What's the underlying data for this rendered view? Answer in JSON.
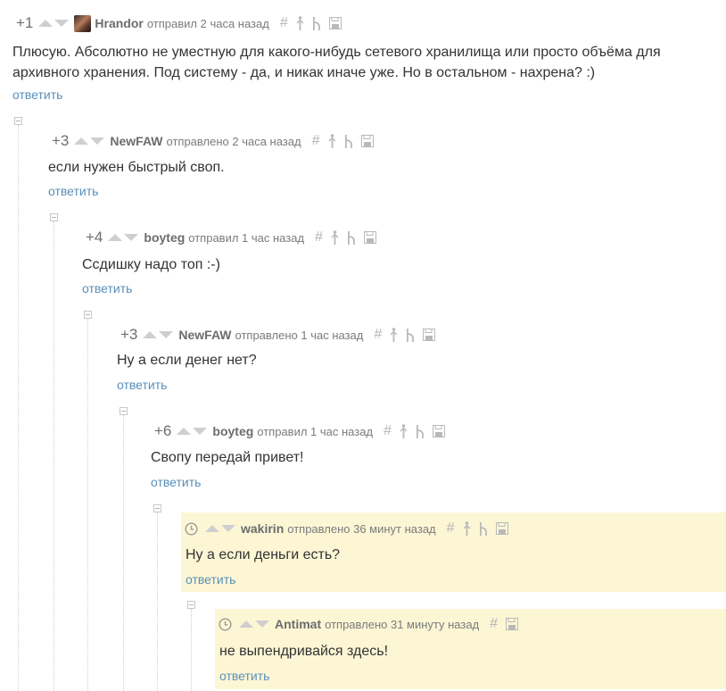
{
  "comments": [
    {
      "rating": "+1",
      "author": "Hrandor",
      "time": "отправил 2 часа назад",
      "text_lines": [
        "Плюсую. Абсолютно не уместную для какого-нибудь сетевого хранилища или просто объёма для",
        "архивного хранения. Под систему - да, и никак иначе уже. Но в остальном - нахрена? :)"
      ],
      "reply": "ответить"
    },
    {
      "rating": "+3",
      "author": "NewFAW",
      "time": "отправлено 2 часа назад",
      "text": "если нужен быстрый своп.",
      "reply": "ответить"
    },
    {
      "rating": "+4",
      "author": "boyteg",
      "time": "отправил 1 час назад",
      "text": "Ссдишку надо топ :-)",
      "reply": "ответить"
    },
    {
      "rating": "+3",
      "author": "NewFAW",
      "time": "отправлено 1 час назад",
      "text": "Ну а если денег нет?",
      "reply": "ответить"
    },
    {
      "rating": "+6",
      "author": "boyteg",
      "time": "отправил 1 час назад",
      "text": "Свопу передай привет!",
      "reply": "ответить"
    },
    {
      "author": "wakirin",
      "time": "отправлено 36 минут назад",
      "text": "Ну а если деньги есть?",
      "reply": "ответить"
    },
    {
      "author": "Antimat",
      "time": "отправлено 31 минуту назад",
      "text": "не выпендривайся здесь!",
      "reply": "ответить"
    }
  ],
  "icons": {
    "hash": "#",
    "parent": "arrow-up-icon",
    "branch": "branch-icon",
    "save": "save-icon",
    "clock": "clock-icon",
    "collapse": "collapse-minus-icon"
  },
  "colors": {
    "highlight_bg": "#fcf6d5",
    "link": "#5a8fb8",
    "text": "#333333",
    "meta": "#7b7b7b"
  }
}
